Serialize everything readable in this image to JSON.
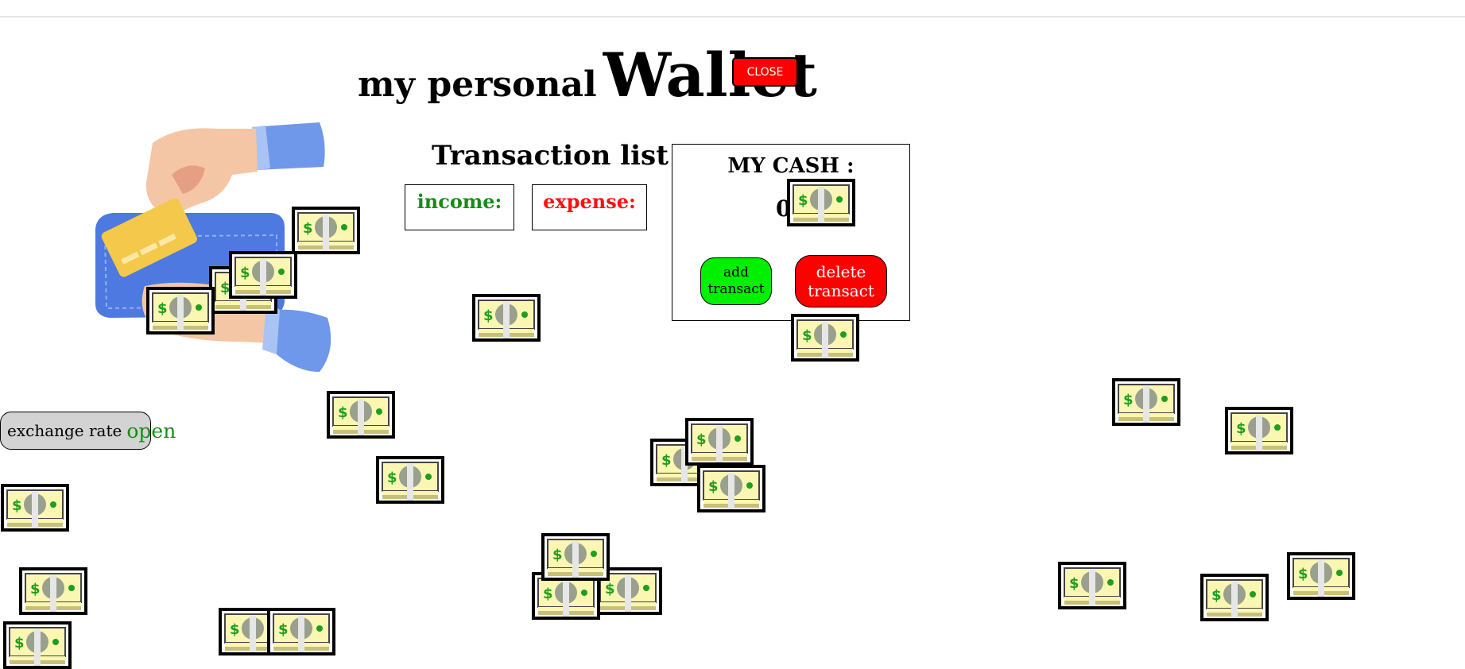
{
  "header": {
    "title_small": "my personal",
    "title_big": "Wallet",
    "close_label": "CLOSE"
  },
  "transactions": {
    "title": "Transaction list",
    "income_label": "income:",
    "expense_label": "expense:"
  },
  "cash": {
    "title": "MY CASH :",
    "value": "0",
    "add_label": "add transact",
    "delete_label": "delete transact"
  },
  "exchange": {
    "label": "exchange rate",
    "link": "open"
  },
  "colors": {
    "close_bg": "#ff0000",
    "income": "#168c16",
    "expense": "#ff1010",
    "add_bg": "#00f000",
    "delete_bg": "#ff0000",
    "exchange_bg": "#d3d3d3"
  },
  "icons": {
    "illustration": "hand-wallet-card-illustration",
    "bill": "dollar-bill-icon"
  }
}
